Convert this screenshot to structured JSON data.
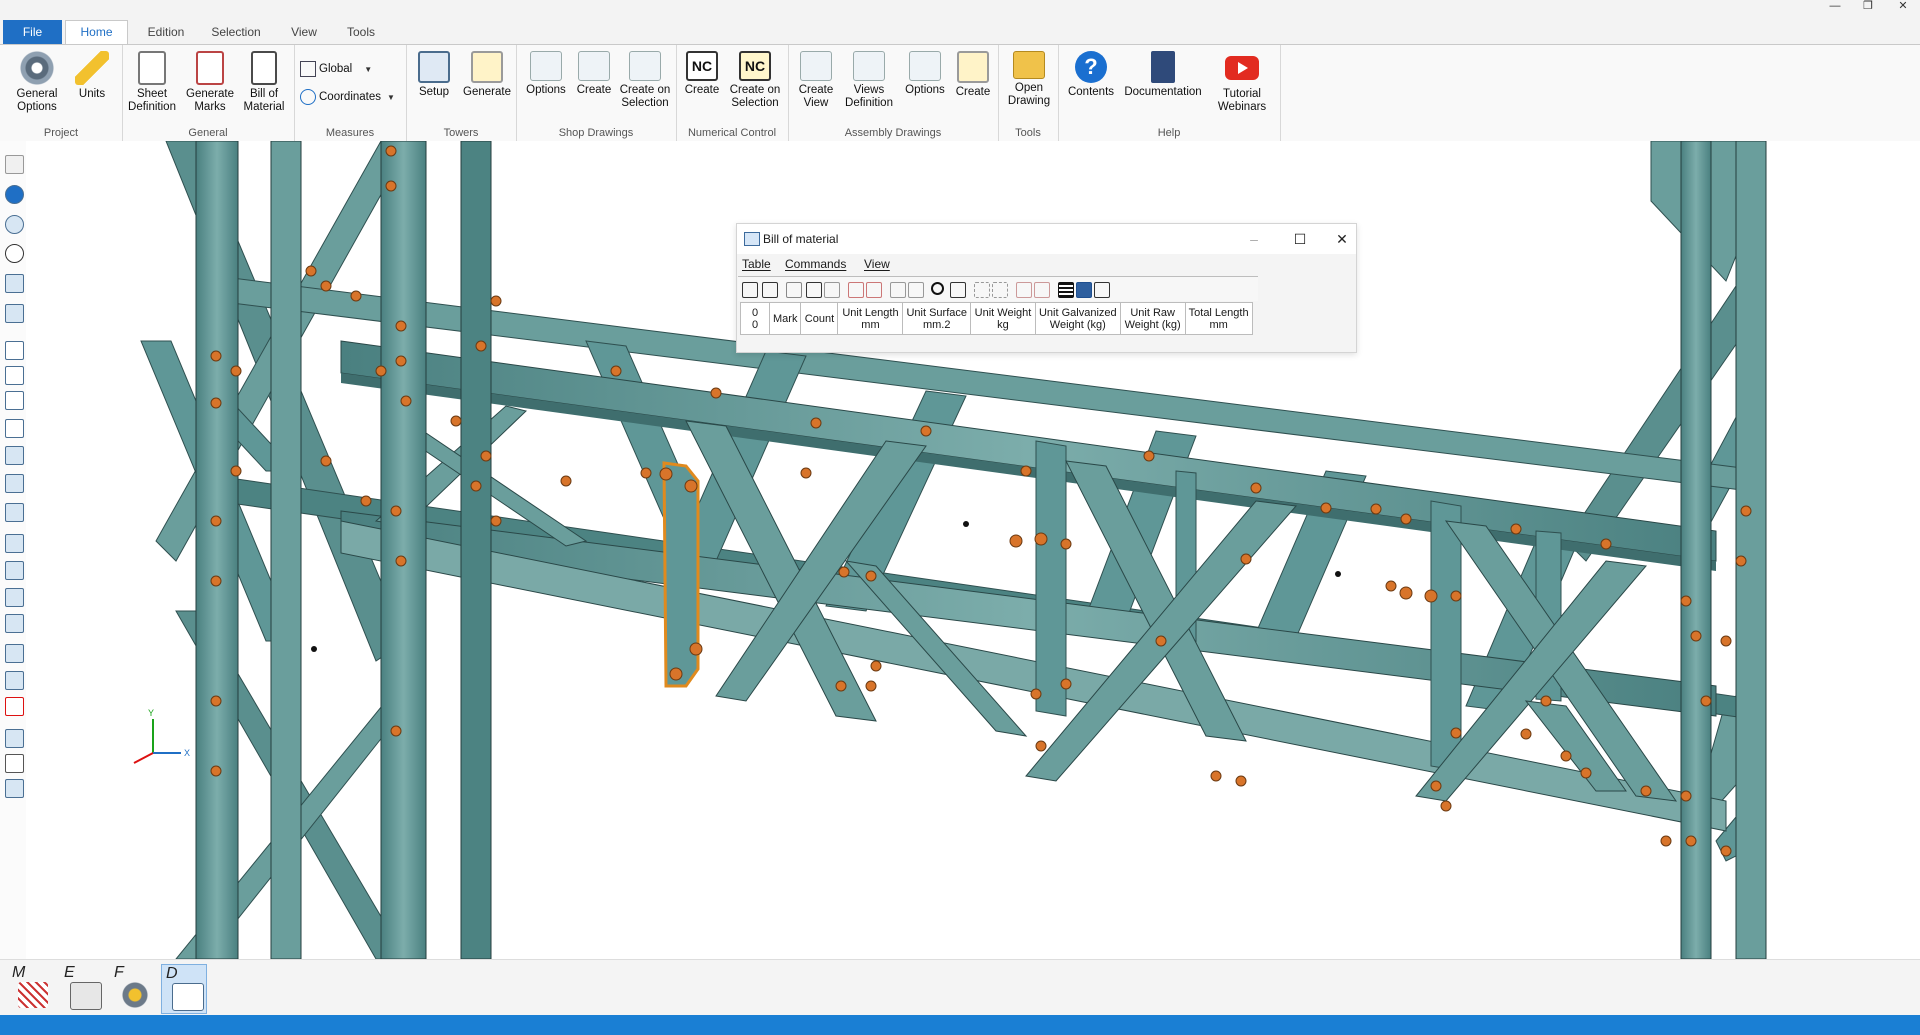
{
  "tabs": {
    "file": "File",
    "home": "Home",
    "edition": "Edition",
    "selection": "Selection",
    "view": "View",
    "tools": "Tools"
  },
  "window_controls": {
    "minimize": "—",
    "restore": "❐",
    "close": "✕"
  },
  "ribbon": {
    "project": {
      "label": "Project",
      "general_options": "General\nOptions",
      "units": "Units"
    },
    "general": {
      "label": "General",
      "sheet_definition": "Sheet\nDefinition",
      "generate_marks": "Generate\nMarks",
      "bill_of_material": "Bill of\nMaterial"
    },
    "measures": {
      "label": "Measures",
      "global": "Global",
      "coordinates": "Coordinates"
    },
    "towers": {
      "label": "Towers",
      "setup": "Setup",
      "generate": "Generate"
    },
    "shop_drawings": {
      "label": "Shop Drawings",
      "options": "Options",
      "create": "Create",
      "create_on_selection": "Create on\nSelection"
    },
    "numerical_control": {
      "label": "Numerical Control",
      "create": "Create",
      "create_on_selection": "Create on\nSelection",
      "nc_text": "NC"
    },
    "assembly_drawings": {
      "label": "Assembly Drawings",
      "create_view": "Create\nView",
      "views_definition": "Views\nDefinition",
      "options": "Options",
      "create": "Create"
    },
    "tools": {
      "label": "Tools",
      "open_drawing": "Open\nDrawing"
    },
    "help": {
      "label": "Help",
      "contents": "Contents",
      "documentation": "Documentation",
      "tutorial_webinars": "Tutorial\nWebinars",
      "help_glyph": "?"
    }
  },
  "bom_window": {
    "title": "Bill of material",
    "menu": [
      "Table",
      "Commands",
      "View"
    ],
    "columns": [
      "0\n0",
      "Mark",
      "Count",
      "Unit Length\nmm",
      "Unit Surface\nmm.2",
      "Unit Weight\nkg",
      "Unit Galvanized\nWeight (kg)",
      "Unit Raw\nWeight (kg)",
      "Total Length\nmm"
    ]
  },
  "modes": [
    {
      "letter": "M",
      "active": false
    },
    {
      "letter": "E",
      "active": false
    },
    {
      "letter": "F",
      "active": false
    },
    {
      "letter": "D",
      "active": true
    }
  ],
  "axis": {
    "y": "Y",
    "x": "X"
  },
  "colors": {
    "steel": "#5f9797",
    "steel_dark": "#3f6e6e",
    "steel_light": "#86b3b1",
    "bolt": "#d8742a",
    "selection": "#e08a1e",
    "accent": "#1f6fc5",
    "status": "#1a7fd4"
  }
}
